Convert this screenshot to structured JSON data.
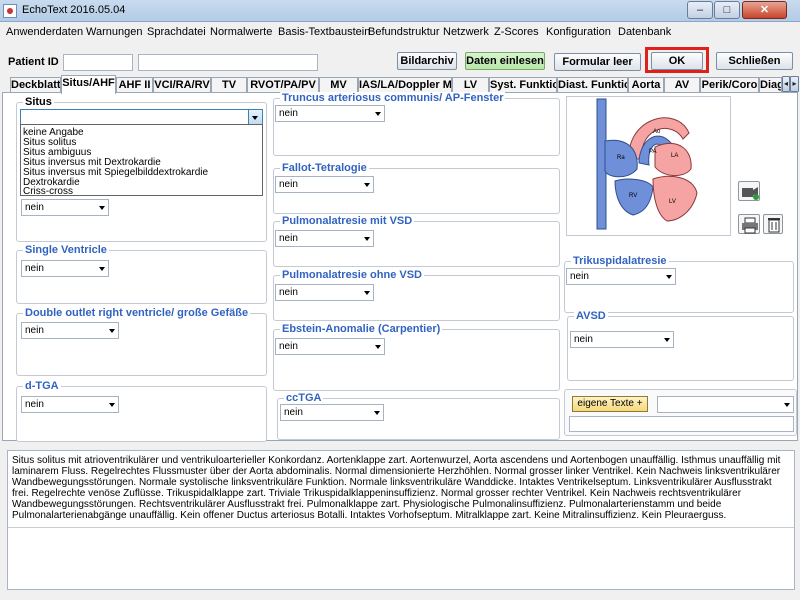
{
  "window": {
    "title": "EchoText 2016.05.04",
    "minimize": "–",
    "maximize": "□",
    "close": "✕"
  },
  "menu": [
    "Anwenderdaten",
    "Warnungen",
    "Sprachdatei",
    "Normalwerte",
    "Basis-Textbaustein",
    "Befundstruktur",
    "Netzwerk",
    "Z-Scores",
    "Konfiguration",
    "Datenbank"
  ],
  "toolbar": {
    "patient_id_label": "Patient ID",
    "patient_id_value": "",
    "patient_name_value": "",
    "bildarchiv": "Bildarchiv",
    "daten_einlesen": "Daten einlesen",
    "formular_leer": "Formular leer",
    "ok": "OK",
    "schliessen": "Schließen"
  },
  "tabs": [
    "Deckblatt",
    "Situs/AHF",
    "AHF II",
    "VCI/RA/RV",
    "TV",
    "RVOT/PA/PV",
    "MV",
    "IAS/LA/Doppler MV",
    "LV",
    "Syst. Funktion",
    "Diast. Funktion",
    "Aorta",
    "AV",
    "Perik/Coro",
    "Diag"
  ],
  "active_tab": "Situs/AHF",
  "situs": {
    "label": "Situs",
    "value": "",
    "options": [
      "keine Angabe",
      "Situs solitus",
      "Situs ambiguus",
      "Situs inversus mit Dextrokardie",
      "Situs inversus mit Spiegelbilddextrokardie",
      "Dextrokardie",
      "Criss-cross"
    ]
  },
  "groups": {
    "hidden_group": {
      "value": "nein"
    },
    "single_ventricle": {
      "title": "Single Ventricle",
      "value": "nein"
    },
    "dorv": {
      "title": "Double outlet right ventricle/ große Gefäße",
      "value": "nein"
    },
    "dtga": {
      "title": "d-TGA",
      "value": "nein"
    },
    "truncus": {
      "title": "Truncus arteriosus communis/ AP-Fenster",
      "value": "nein"
    },
    "fallot": {
      "title": "Fallot-Tetralogie",
      "value": "nein"
    },
    "pa_vsd": {
      "title": "Pulmonalatresie mit VSD",
      "value": "nein"
    },
    "pa_ivs": {
      "title": "Pulmonalatresie ohne VSD",
      "value": "nein"
    },
    "ebstein": {
      "title": "Ebstein-Anomalie (Carpentier)",
      "value": "nein"
    },
    "cctga": {
      "title": "ccTGA",
      "value": "nein"
    },
    "trikuspidal": {
      "title": "Trikuspidalatresie",
      "value": "nein"
    },
    "avsd": {
      "title": "AVSD",
      "value": "nein"
    }
  },
  "heart_labels": {
    "ao": "Ao",
    "pa": "PA",
    "la": "LA",
    "ra": "Ra",
    "rv": "RV",
    "lv": "LV"
  },
  "icons": [
    "video-camera-icon",
    "printer-icon",
    "trash-icon"
  ],
  "eigene_texte": {
    "label": "eigene Texte +",
    "value": ""
  },
  "report_text": "Situs solitus mit atrioventrikulärer und ventrikuloarterieller Konkordanz. Aortenklappe zart. Aortenwurzel, Aorta ascendens und Aortenbogen unauffällig. Isthmus unauffällig mit laminarem Fluss. Regelrechtes Flussmuster über der Aorta abdominalis. Normal dimensionierte Herzhöhlen. Normal grosser linker Ventrikel. Kein Nachweis linksventrikulärer Wandbewegungsstörungen. Normale systolische linksventrikuläre Funktion. Normale linksventrikuläre Wanddicke. Intaktes Ventrikelseptum. Linksventrikulärer Ausflusstrakt frei. Regelrechte venöse Zuflüsse. Trikuspidalklappe zart. Triviale Trikuspidalklappeninsuffizienz. Normal grosser rechter Ventrikel. Kein Nachweis rechtsventrikulärer Wandbewegungsstörungen. Rechtsventrikulärer Ausflusstrakt frei. Pulmonalklappe zart. Physiologische Pulmonalinsuffizienz. Pulmonalarterienstamm und beide Pulmonalarterienabgänge unauffällig. Kein offener Ductus arteriosus Botalli. Intaktes Vorhofseptum. Mitralklappe zart. Keine Mitralinsuffizienz. Kein Pleuraerguss."
}
